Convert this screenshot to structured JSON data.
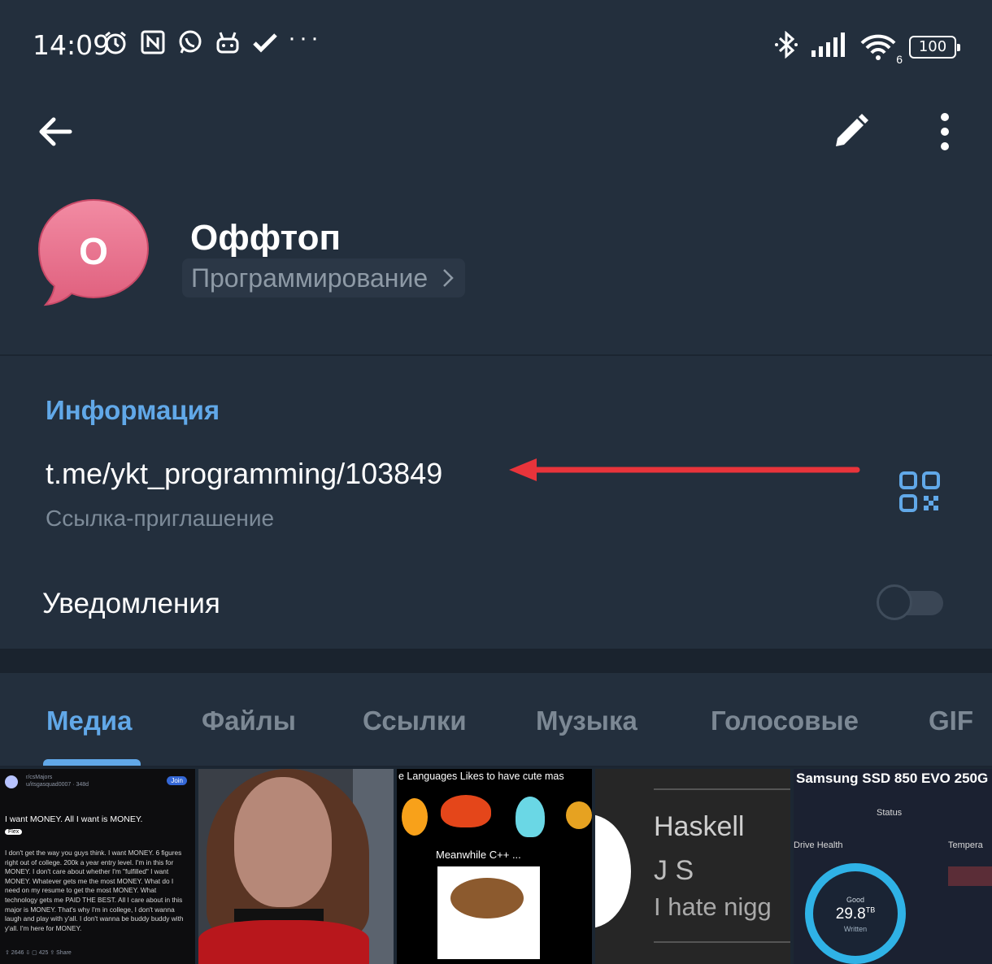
{
  "status_bar": {
    "time": "14:09",
    "icons_left": [
      "alarm-icon",
      "nfc-icon",
      "whatsapp-icon",
      "bot-icon",
      "done-icon"
    ],
    "more": "···",
    "icons_right": [
      "bluetooth-icon",
      "signal-icon",
      "wifi-icon"
    ],
    "wifi_badge": "6",
    "battery": "100"
  },
  "header": {
    "title": "Оффтоп",
    "category": "Программирование",
    "avatar_letter": "O",
    "avatar_color": "#e9708b"
  },
  "info": {
    "heading": "Информация",
    "link": "t.me/ykt_programming/103849",
    "link_caption": "Ссылка-приглашение",
    "notifications_label": "Уведомления",
    "notifications_on": false,
    "annotation_arrow_color": "#e8343b"
  },
  "tabs": [
    {
      "label": "Медиа",
      "active": true
    },
    {
      "label": "Файлы",
      "active": false
    },
    {
      "label": "Ссылки",
      "active": false
    },
    {
      "label": "Музыка",
      "active": false
    },
    {
      "label": "Голосовые",
      "active": false
    },
    {
      "label": "GIF",
      "active": false
    }
  ],
  "media": {
    "thumb1": {
      "sub": "r/csMajors\nu/itsgasquad0007 · 348d",
      "join": "Join",
      "title": "I want MONEY. All I want is MONEY.",
      "flair": "Flex",
      "body": "I don't get the way you guys think. I want MONEY. 6 figures right out of college. 200k a year entry level. I'm in this for MONEY. I don't care about whether I'm \"fulfilled\" I want MONEY. Whatever gets me the most MONEY. What do I need on my resume to get the most MONEY. What technology gets me PAID THE BEST. All I care about in this major is MONEY. That's why I'm in college, I don't wanna laugh and play with y'all. I don't wanna be buddy buddy with y'all. I'm here for MONEY.",
      "footer": "⇧ 2646 ⇩     ▢ 425     ⇪ Share"
    },
    "thumb3": {
      "top": "e Languages Likes to have cute mas",
      "mid": "Meanwhile C++ ..."
    },
    "thumb4": {
      "line1": "Haskell",
      "line2": "J S",
      "line3": "I hate nigg"
    },
    "thumb5": {
      "title": "Samsung SSD 850 EVO 250G",
      "status": "Status",
      "drive_health": "Drive Health",
      "temperature": "Tempera",
      "good": "Good",
      "written": "29.8",
      "written_unit": "TB",
      "written_label": "Written"
    }
  }
}
